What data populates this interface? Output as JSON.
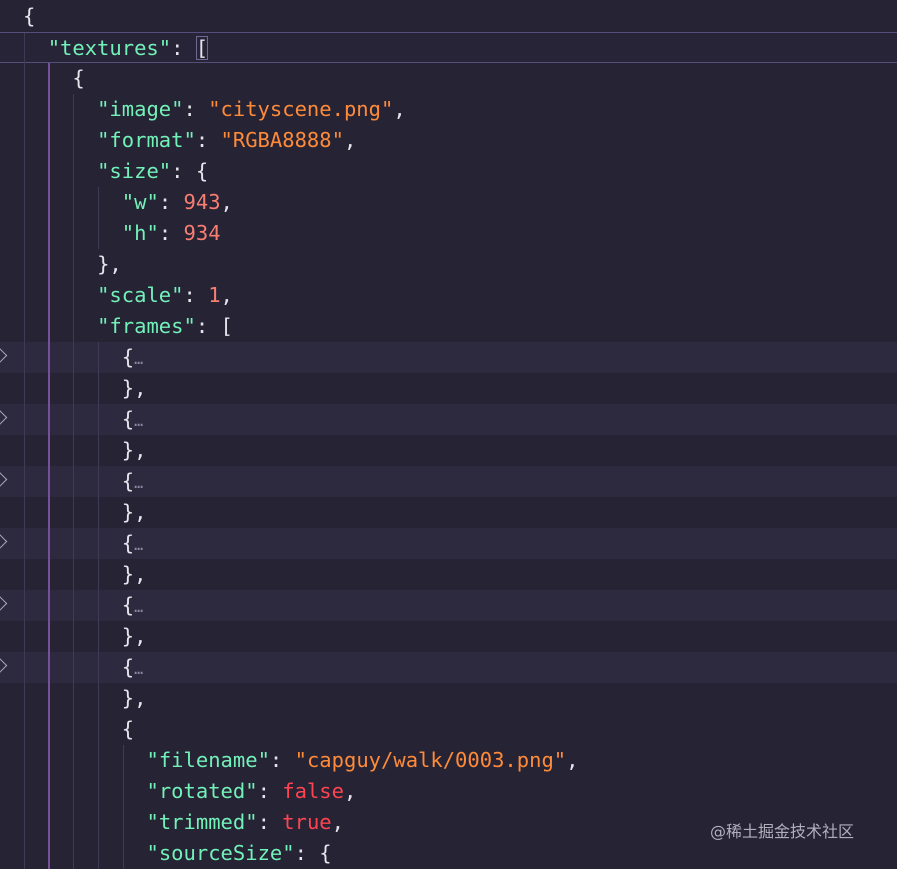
{
  "lines": [
    {
      "indent": 0,
      "tokens": [
        {
          "t": "p",
          "v": "{"
        }
      ]
    },
    {
      "indent": 1,
      "current": true,
      "tokens": [
        {
          "t": "k",
          "v": "\"textures\""
        },
        {
          "t": "p",
          "v": ": "
        },
        {
          "t": "p",
          "v": "[",
          "hl": true
        }
      ]
    },
    {
      "indent": 2,
      "tokens": [
        {
          "t": "p",
          "v": "{"
        }
      ]
    },
    {
      "indent": 3,
      "tokens": [
        {
          "t": "k",
          "v": "\"image\""
        },
        {
          "t": "p",
          "v": ": "
        },
        {
          "t": "s",
          "v": "\"cityscene.png\""
        },
        {
          "t": "p",
          "v": ","
        }
      ]
    },
    {
      "indent": 3,
      "tokens": [
        {
          "t": "k",
          "v": "\"format\""
        },
        {
          "t": "p",
          "v": ": "
        },
        {
          "t": "s",
          "v": "\"RGBA8888\""
        },
        {
          "t": "p",
          "v": ","
        }
      ]
    },
    {
      "indent": 3,
      "tokens": [
        {
          "t": "k",
          "v": "\"size\""
        },
        {
          "t": "p",
          "v": ": {"
        }
      ]
    },
    {
      "indent": 4,
      "tokens": [
        {
          "t": "k",
          "v": "\"w\""
        },
        {
          "t": "p",
          "v": ": "
        },
        {
          "t": "n",
          "v": "943"
        },
        {
          "t": "p",
          "v": ","
        }
      ]
    },
    {
      "indent": 4,
      "tokens": [
        {
          "t": "k",
          "v": "\"h\""
        },
        {
          "t": "p",
          "v": ": "
        },
        {
          "t": "n",
          "v": "934"
        }
      ]
    },
    {
      "indent": 3,
      "tokens": [
        {
          "t": "p",
          "v": "},"
        }
      ]
    },
    {
      "indent": 3,
      "tokens": [
        {
          "t": "k",
          "v": "\"scale\""
        },
        {
          "t": "p",
          "v": ": "
        },
        {
          "t": "n",
          "v": "1"
        },
        {
          "t": "p",
          "v": ","
        }
      ]
    },
    {
      "indent": 3,
      "tokens": [
        {
          "t": "k",
          "v": "\"frames\""
        },
        {
          "t": "p",
          "v": ": ["
        }
      ]
    },
    {
      "indent": 4,
      "folded": true,
      "tokens": [
        {
          "t": "p",
          "v": "{"
        },
        {
          "t": "e",
          "v": "…"
        }
      ]
    },
    {
      "indent": 4,
      "tokens": [
        {
          "t": "p",
          "v": "},"
        }
      ]
    },
    {
      "indent": 4,
      "folded": true,
      "tokens": [
        {
          "t": "p",
          "v": "{"
        },
        {
          "t": "e",
          "v": "…"
        }
      ]
    },
    {
      "indent": 4,
      "tokens": [
        {
          "t": "p",
          "v": "},"
        }
      ]
    },
    {
      "indent": 4,
      "folded": true,
      "tokens": [
        {
          "t": "p",
          "v": "{"
        },
        {
          "t": "e",
          "v": "…"
        }
      ]
    },
    {
      "indent": 4,
      "tokens": [
        {
          "t": "p",
          "v": "},"
        }
      ]
    },
    {
      "indent": 4,
      "folded": true,
      "tokens": [
        {
          "t": "p",
          "v": "{"
        },
        {
          "t": "e",
          "v": "…"
        }
      ]
    },
    {
      "indent": 4,
      "tokens": [
        {
          "t": "p",
          "v": "},"
        }
      ]
    },
    {
      "indent": 4,
      "folded": true,
      "tokens": [
        {
          "t": "p",
          "v": "{"
        },
        {
          "t": "e",
          "v": "…"
        }
      ]
    },
    {
      "indent": 4,
      "tokens": [
        {
          "t": "p",
          "v": "},"
        }
      ]
    },
    {
      "indent": 4,
      "folded": true,
      "tokens": [
        {
          "t": "p",
          "v": "{"
        },
        {
          "t": "e",
          "v": "…"
        }
      ]
    },
    {
      "indent": 4,
      "tokens": [
        {
          "t": "p",
          "v": "},"
        }
      ]
    },
    {
      "indent": 4,
      "tokens": [
        {
          "t": "p",
          "v": "{"
        }
      ]
    },
    {
      "indent": 5,
      "tokens": [
        {
          "t": "k",
          "v": "\"filename\""
        },
        {
          "t": "p",
          "v": ": "
        },
        {
          "t": "s",
          "v": "\"capguy/walk/0003.png\""
        },
        {
          "t": "p",
          "v": ","
        }
      ]
    },
    {
      "indent": 5,
      "tokens": [
        {
          "t": "k",
          "v": "\"rotated\""
        },
        {
          "t": "p",
          "v": ": "
        },
        {
          "t": "b",
          "v": "false"
        },
        {
          "t": "p",
          "v": ","
        }
      ]
    },
    {
      "indent": 5,
      "tokens": [
        {
          "t": "k",
          "v": "\"trimmed\""
        },
        {
          "t": "p",
          "v": ": "
        },
        {
          "t": "b",
          "v": "true"
        },
        {
          "t": "p",
          "v": ","
        }
      ]
    },
    {
      "indent": 5,
      "tokens": [
        {
          "t": "k",
          "v": "\"sourceSize\""
        },
        {
          "t": "p",
          "v": ": {"
        }
      ]
    }
  ],
  "watermark": "@稀土掘金技术社区"
}
